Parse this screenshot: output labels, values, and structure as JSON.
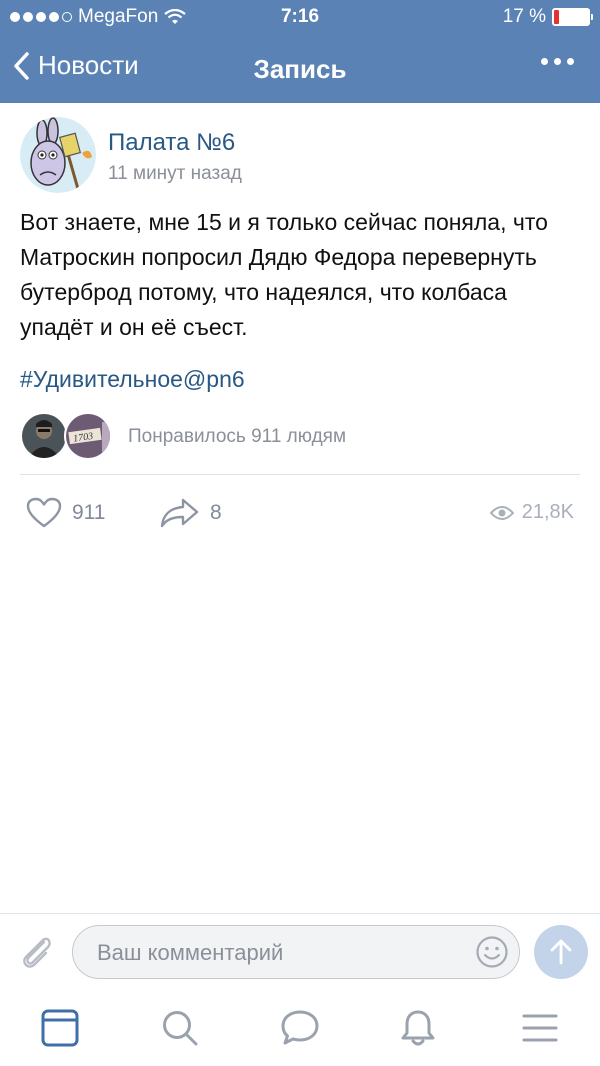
{
  "status_bar": {
    "carrier": "MegaFon",
    "time": "7:16",
    "battery": "17 %"
  },
  "nav": {
    "back_label": "Новости",
    "title": "Запись"
  },
  "post": {
    "author": "Палата №6",
    "time": "11 минут назад",
    "text": "Вот знаете, мне 15 и я только сейчас поняла, что Матроскин попросил Дядю Федора перевернуть бутерброд потому, что надеялся, что колбаса упадёт и он её съест.",
    "hashtag": "#Удивительное@pn6",
    "liked_by": "Понравилось 911 людям",
    "liker_badge": "1703",
    "likes": "911",
    "shares": "8",
    "views": "21,8K"
  },
  "composer": {
    "placeholder": "Ваш комментарий"
  },
  "tabbar": {
    "items": [
      "news-tab",
      "search-tab",
      "messages-tab",
      "notifications-tab",
      "menu-tab"
    ]
  },
  "colors": {
    "header": "#5b82b4",
    "link": "#2a5885",
    "muted": "#8a8f99",
    "battery_low": "#e5312f",
    "send_bg": "#c3d4ea"
  }
}
